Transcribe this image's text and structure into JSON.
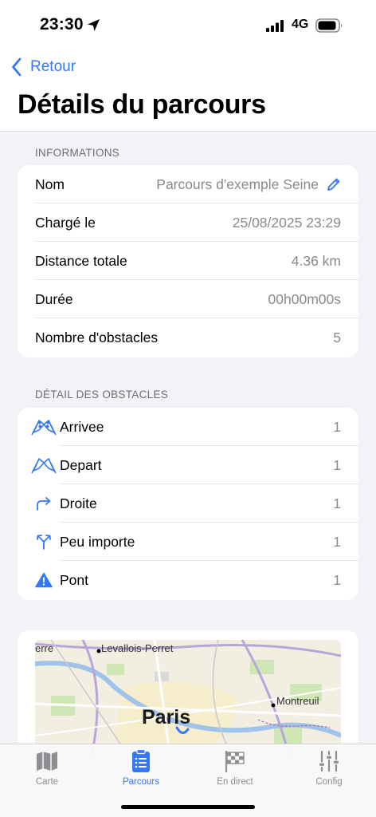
{
  "status": {
    "time": "23:30",
    "network": "4G"
  },
  "nav": {
    "back_label": "Retour",
    "title": "Détails du parcours"
  },
  "informations": {
    "header": "INFORMATIONS",
    "rows": [
      {
        "label": "Nom",
        "value": "Parcours d'exemple Seine"
      },
      {
        "label": "Chargé le",
        "value": "25/08/2025 23:29"
      },
      {
        "label": "Distance totale",
        "value": "4.36 km"
      },
      {
        "label": "Durée",
        "value": "00h00m00s"
      },
      {
        "label": "Nombre d'obstacles",
        "value": "5"
      }
    ]
  },
  "obstacles": {
    "header": "DÉTAIL DES OBSTACLES",
    "rows": [
      {
        "label": "Arrivee",
        "count": "1",
        "icon": "checkered-flags-icon"
      },
      {
        "label": "Depart",
        "count": "1",
        "icon": "flags-outline-icon"
      },
      {
        "label": "Droite",
        "count": "1",
        "icon": "turn-right-arrow-icon"
      },
      {
        "label": "Peu importe",
        "count": "1",
        "icon": "fork-arrow-icon"
      },
      {
        "label": "Pont",
        "count": "1",
        "icon": "warning-triangle-icon"
      }
    ]
  },
  "map": {
    "labels": {
      "edge": "erre",
      "levallois": "Levallois-Perret",
      "paris": "Paris",
      "montreuil": "Montreuil"
    }
  },
  "tabs": [
    {
      "label": "Carte",
      "icon": "map-icon",
      "active": false
    },
    {
      "label": "Parcours",
      "icon": "clipboard-icon",
      "active": true
    },
    {
      "label": "En direct",
      "icon": "checkered-flag-icon",
      "active": false
    },
    {
      "label": "Config",
      "icon": "sliders-icon",
      "active": false
    }
  ],
  "colors": {
    "accent": "#3478f6",
    "secondary_text": "#8a8a8e",
    "background": "#f2f2f7"
  }
}
